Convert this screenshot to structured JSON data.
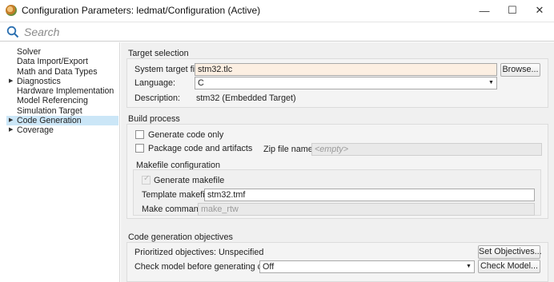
{
  "window": {
    "title": "Configuration Parameters: ledmat/Configuration (Active)",
    "minimize": "—",
    "maximize": "☐",
    "close": "✕"
  },
  "search": {
    "placeholder": "Search"
  },
  "sidebar": {
    "items": [
      {
        "label": "Solver",
        "arrow": ""
      },
      {
        "label": "Data Import/Export",
        "arrow": ""
      },
      {
        "label": "Math and Data Types",
        "arrow": ""
      },
      {
        "label": "Diagnostics",
        "arrow": "▶"
      },
      {
        "label": "Hardware Implementation",
        "arrow": ""
      },
      {
        "label": "Model Referencing",
        "arrow": ""
      },
      {
        "label": "Simulation Target",
        "arrow": ""
      },
      {
        "label": "Code Generation",
        "arrow": "▶"
      },
      {
        "label": "Coverage",
        "arrow": "▶"
      }
    ]
  },
  "target_selection": {
    "title": "Target selection",
    "system_target_file_label": "System target file:",
    "system_target_file_value": "stm32.tlc",
    "browse": "Browse...",
    "language_label": "Language:",
    "language_value": "C",
    "description_label": "Description:",
    "description_value": "stm32 (Embedded Target)"
  },
  "build_process": {
    "title": "Build process",
    "generate_code_only": "Generate code only",
    "package_code": "Package code and artifacts",
    "zip_file_label": "Zip file name:",
    "zip_file_placeholder": "<empty>",
    "makefile_title": "Makefile configuration",
    "generate_makefile": "Generate makefile",
    "template_makefile_label": "Template makefile:",
    "template_makefile_value": "stm32.tmf",
    "make_command_label": "Make command:",
    "make_command_value": "make_rtw"
  },
  "objectives": {
    "title": "Code generation objectives",
    "prioritized_label": "Prioritized objectives:",
    "prioritized_value": "Unspecified",
    "set_objectives": "Set Objectives...",
    "check_model_label": "Check model before generating code:",
    "check_model_value": "Off",
    "check_model_button": "Check Model..."
  }
}
